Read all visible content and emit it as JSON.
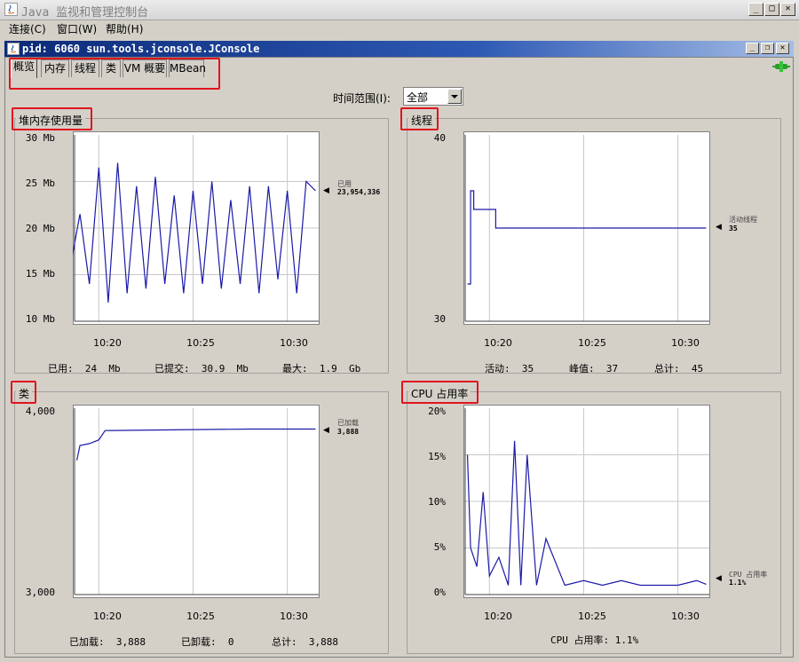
{
  "window": {
    "title": "Java 监视和管理控制台"
  },
  "menu": [
    "连接(C)",
    "窗口(W)",
    "帮助(H)"
  ],
  "frame": {
    "title": "pid: 6060 sun.tools.jconsole.JConsole"
  },
  "tabs": [
    "概览",
    "内存",
    "线程",
    "类",
    "VM 概要",
    "MBean"
  ],
  "time_range": {
    "label": "时间范围(I):",
    "value": "全部"
  },
  "panels": {
    "heap": {
      "title": "堆内存使用量",
      "y_ticks": [
        "30 Mb",
        "25 Mb",
        "20 Mb",
        "15 Mb",
        "10 Mb"
      ],
      "x_ticks": [
        "10:20",
        "10:25",
        "10:30"
      ],
      "marker_label": "已用",
      "marker_value": "23,954,336",
      "stats": [
        {
          "label": "已用:",
          "value": "24",
          "unit": "Mb"
        },
        {
          "label": "已提交:",
          "value": "30.9",
          "unit": "Mb"
        },
        {
          "label": "最大:",
          "value": "1.9",
          "unit": "Gb"
        }
      ]
    },
    "threads": {
      "title": "线程",
      "y_ticks": [
        "40",
        "30"
      ],
      "x_ticks": [
        "10:20",
        "10:25",
        "10:30"
      ],
      "marker_label": "活动线程",
      "marker_value": "35",
      "stats": [
        {
          "label": "活动:",
          "value": "35"
        },
        {
          "label": "峰值:",
          "value": "37"
        },
        {
          "label": "总计:",
          "value": "45"
        }
      ]
    },
    "classes": {
      "title": "类",
      "y_ticks": [
        "4,000",
        "3,000"
      ],
      "x_ticks": [
        "10:20",
        "10:25",
        "10:30"
      ],
      "marker_label": "已加载",
      "marker_value": "3,888",
      "stats": [
        {
          "label": "已加载:",
          "value": "3,888"
        },
        {
          "label": "已卸载:",
          "value": "0"
        },
        {
          "label": "总计:",
          "value": "3,888"
        }
      ]
    },
    "cpu": {
      "title": "CPU 占用率",
      "y_ticks": [
        "20%",
        "15%",
        "10%",
        "5%",
        "0%"
      ],
      "x_ticks": [
        "10:20",
        "10:25",
        "10:30"
      ],
      "marker_label": "CPU 占用率",
      "marker_value": "1.1%",
      "stats_text": "CPU 占用率: 1.1%"
    }
  },
  "chart_data": [
    {
      "type": "line",
      "title": "堆内存使用量",
      "ylabel": "Mb",
      "ylim": [
        10,
        30
      ],
      "x": [
        "10:18:30",
        "10:19",
        "10:19:30",
        "10:20",
        "10:20:30",
        "10:21",
        "10:21:30",
        "10:22",
        "10:22:30",
        "10:23",
        "10:23:30",
        "10:24",
        "10:24:30",
        "10:25",
        "10:25:30",
        "10:26",
        "10:26:30",
        "10:27",
        "10:27:30",
        "10:28",
        "10:28:30",
        "10:29",
        "10:29:30",
        "10:30",
        "10:30:30",
        "10:31",
        "10:31:30"
      ],
      "series": [
        {
          "name": "已用",
          "values": [
            16,
            21.5,
            14,
            26.5,
            12,
            27,
            13,
            24.5,
            13.5,
            25.5,
            14,
            23.5,
            13,
            24,
            14,
            25,
            13.5,
            23,
            14,
            24.5,
            13,
            24.5,
            14.5,
            24,
            13,
            25,
            24
          ]
        }
      ],
      "grid": true,
      "color": "#1a1aa8"
    },
    {
      "type": "line",
      "title": "线程",
      "ylim": [
        30,
        40
      ],
      "x": [
        "10:18:50",
        "10:19",
        "10:19:10",
        "10:20",
        "10:20:20",
        "10:25",
        "10:30",
        "10:31:30"
      ],
      "series": [
        {
          "name": "活动线程",
          "values": [
            32,
            37,
            36,
            36,
            35,
            35,
            35,
            35
          ]
        }
      ],
      "grid": true,
      "color": "#1a1aa8"
    },
    {
      "type": "line",
      "title": "类",
      "ylim": [
        3000,
        4000
      ],
      "x": [
        "10:18:50",
        "10:19",
        "10:19:30",
        "10:20",
        "10:20:20",
        "10:25",
        "10:28",
        "10:31:30"
      ],
      "series": [
        {
          "name": "已加载",
          "values": [
            3720,
            3800,
            3810,
            3830,
            3880,
            3885,
            3888,
            3888
          ]
        }
      ],
      "grid": true,
      "color": "#1a1aa8"
    },
    {
      "type": "line",
      "title": "CPU 占用率",
      "ylim": [
        0,
        20
      ],
      "x": [
        "10:18:50",
        "10:19",
        "10:19:20",
        "10:19:40",
        "10:20",
        "10:20:30",
        "10:21",
        "10:21:20",
        "10:21:40",
        "10:22",
        "10:22:30",
        "10:23",
        "10:24",
        "10:25",
        "10:26",
        "10:27",
        "10:28",
        "10:29",
        "10:30",
        "10:31",
        "10:31:30"
      ],
      "series": [
        {
          "name": "CPU 占用率",
          "values": [
            15,
            5,
            3,
            11,
            2,
            4,
            1,
            16.5,
            1,
            15,
            1,
            6,
            1,
            1.5,
            1,
            1.5,
            1,
            1,
            1,
            1.5,
            1.1
          ]
        }
      ],
      "grid": true,
      "color": "#1a1aa8"
    }
  ]
}
